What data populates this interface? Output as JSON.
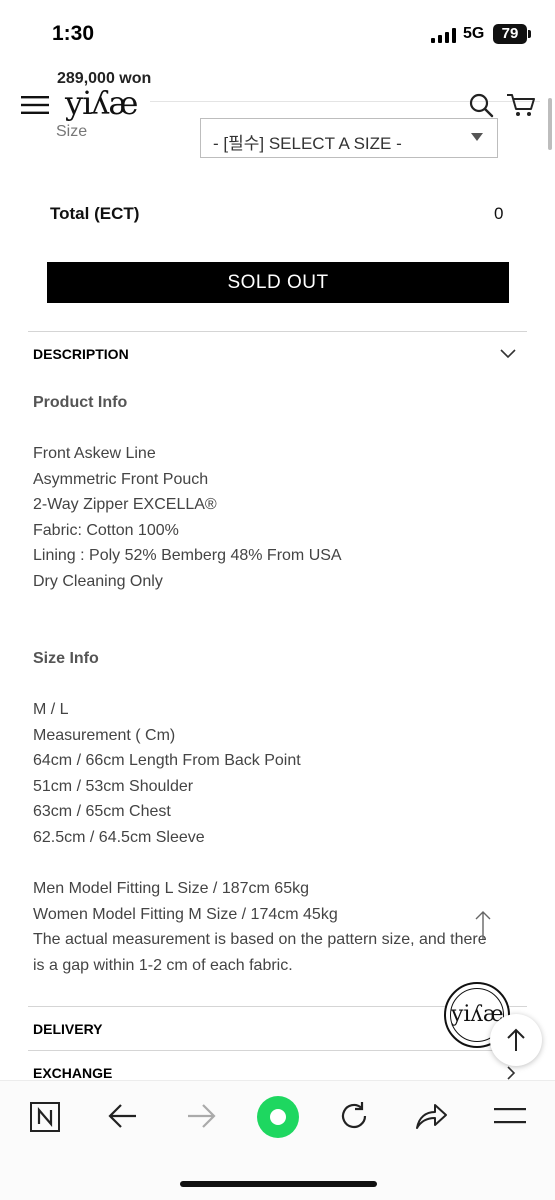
{
  "status_bar": {
    "time": "1:30",
    "network": "5G",
    "battery": "79"
  },
  "header": {
    "price": "289,000 won",
    "logo": "yiʎæ"
  },
  "options": {
    "size_label": "Size",
    "size_select": "- [필수] SELECT A SIZE -"
  },
  "total": {
    "label": "Total (ECT)",
    "value": "0"
  },
  "buy": {
    "sold_out_label": "SOLD OUT"
  },
  "sections": {
    "description": "DESCRIPTION",
    "delivery": "DELIVERY",
    "exchange": "EXCHANGE"
  },
  "product_info": {
    "title": "Product Info",
    "lines": [
      "Front Askew Line",
      "Asymmetric Front Pouch",
      "2-Way Zipper EXCELLA®",
      "Fabric: Cotton 100%",
      "Lining : Poly 52% Bemberg 48% From USA",
      "Dry Cleaning Only"
    ]
  },
  "size_info": {
    "title": "Size Info",
    "lines": [
      "M / L",
      "Measurement ( Cm)",
      "64cm / 66cm Length From Back Point",
      "51cm / 53cm Shoulder",
      "63cm / 65cm Chest",
      "62.5cm / 64.5cm Sleeve"
    ],
    "fitting": [
      "Men Model Fitting L Size / 187cm 65kg",
      "Women Model Fitting M Size / 174cm 45kg",
      "The actual measurement is based on the pattern size, and there",
      "is a gap within 1-2 cm of each fabric."
    ]
  },
  "badge": {
    "text": "yiʎæ"
  },
  "colors": {
    "accent_green": "#1ed760",
    "button_black": "#000000"
  },
  "icons": [
    "menu-icon",
    "search-icon",
    "cart-icon",
    "chevron-down-icon",
    "chevron-right-icon",
    "arrow-up-icon",
    "naver-icon",
    "back-icon",
    "forward-icon",
    "reload-icon",
    "share-icon",
    "more-menu-icon"
  ]
}
